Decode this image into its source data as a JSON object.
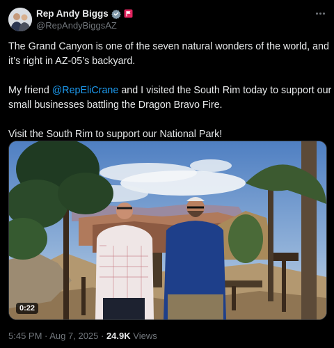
{
  "author": {
    "display_name": "Rep Andy Biggs",
    "handle": "@RepAndyBiggsAZ",
    "verified_icon": "verified-badge-icon",
    "affiliation_icon": "flag-badge-icon",
    "avatar_icon": "profile-photo"
  },
  "more_icon": "more-options-icon",
  "tweet": {
    "line1": "The Grand Canyon is one of the seven natural wonders of the world, and",
    "line2": "it’s right in AZ-05’s backyard.",
    "p2_prefix": "My friend ",
    "p2_mention": "@RepEliCrane",
    "p2_rest": " and I visited the South Rim today to support our",
    "p2_line2": "small businesses battling the Dragon Bravo Fire.",
    "p3": "Visit the South Rim to support our National Park!"
  },
  "media": {
    "type": "video",
    "duration": "0:22"
  },
  "meta": {
    "time": "5:45 PM",
    "separator": " · ",
    "date": "Aug 7, 2025",
    "views_count": "24.9K",
    "views_label": "Views"
  },
  "colors": {
    "background": "#000000",
    "text": "#e7e9ea",
    "secondary_text": "#71767b",
    "link": "#1d9bf0",
    "verified": "#829aab",
    "border": "#2f3336"
  }
}
